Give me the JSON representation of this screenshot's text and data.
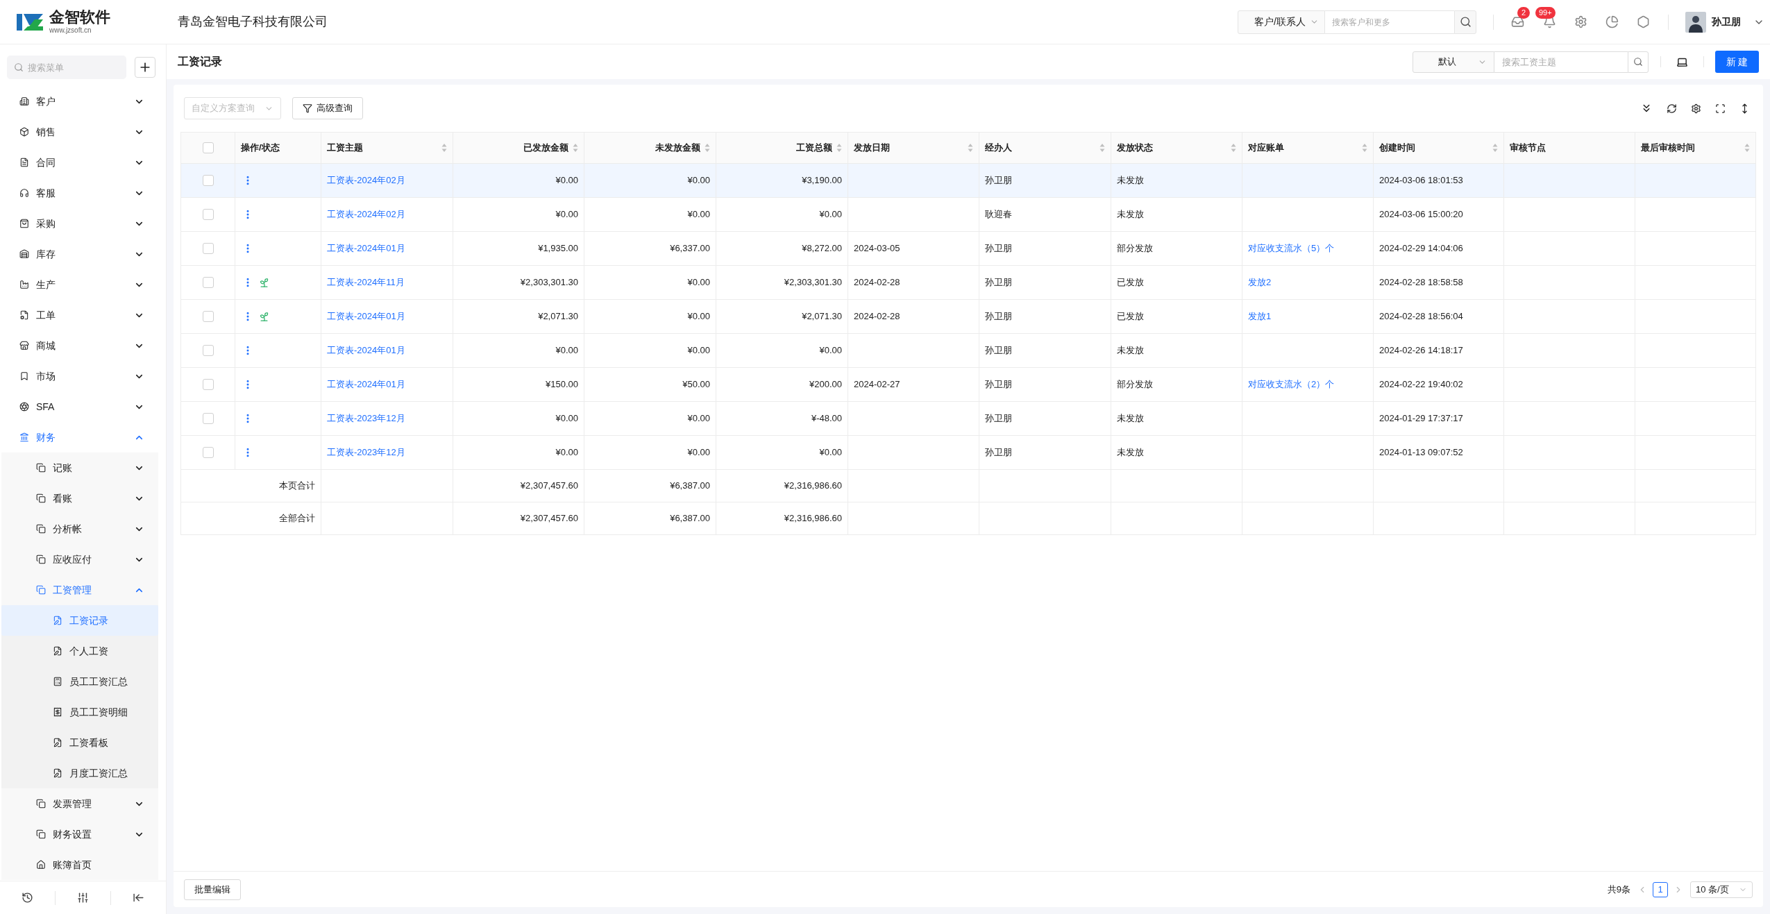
{
  "topbar": {
    "logo": {
      "name": "金智软件",
      "url": "www.jzsoft.cn"
    },
    "company": "青岛金智电子科技有限公司",
    "search": {
      "scope": "客户/联系人",
      "placeholder": "搜索客户和更多"
    },
    "inbox_badge": "2",
    "bell_badge": "99+",
    "user": "孙卫朋"
  },
  "sidebar": {
    "search": {
      "placeholder": "搜索菜单"
    },
    "items": [
      {
        "label": "客户",
        "expanded": false,
        "selected": false
      },
      {
        "label": "销售",
        "expanded": false,
        "selected": false
      },
      {
        "label": "合同",
        "expanded": false,
        "selected": false
      },
      {
        "label": "客服",
        "expanded": false,
        "selected": false
      },
      {
        "label": "采购",
        "expanded": false,
        "selected": false
      },
      {
        "label": "库存",
        "expanded": false,
        "selected": false
      },
      {
        "label": "生产",
        "expanded": false,
        "selected": false
      },
      {
        "label": "工单",
        "expanded": false,
        "selected": false
      },
      {
        "label": "商城",
        "expanded": false,
        "selected": false
      },
      {
        "label": "市场",
        "expanded": false,
        "selected": false
      },
      {
        "label": "SFA",
        "expanded": false,
        "selected": false
      },
      {
        "label": "财务",
        "expanded": true,
        "selected": false,
        "children": [
          {
            "label": "记账",
            "expanded": false,
            "selected": false
          },
          {
            "label": "看账",
            "expanded": false,
            "selected": false
          },
          {
            "label": "分析帐",
            "expanded": false,
            "selected": false
          },
          {
            "label": "应收应付",
            "expanded": false,
            "selected": false
          },
          {
            "label": "工资管理",
            "expanded": true,
            "selected": false,
            "children": [
              {
                "label": "工资记录",
                "selected": true
              },
              {
                "label": "个人工资",
                "selected": false
              },
              {
                "label": "员工工资汇总",
                "selected": false
              },
              {
                "label": "员工工资明细",
                "selected": false
              },
              {
                "label": "工资看板",
                "selected": false
              },
              {
                "label": "月度工资汇总",
                "selected": false
              }
            ]
          },
          {
            "label": "发票管理",
            "expanded": false,
            "selected": false
          },
          {
            "label": "财务设置",
            "expanded": false,
            "selected": false
          },
          {
            "label": "账簿首页",
            "selected": false
          }
        ]
      }
    ]
  },
  "page": {
    "title": "工资记录",
    "view": "默认",
    "search": {
      "placeholder": "搜索工资主题"
    },
    "new_button": "新 建"
  },
  "toolbar": {
    "scheme": {
      "placeholder": "自定义方案查询"
    },
    "advanced": "高级查询"
  },
  "table": {
    "select_all": {
      "checked": false
    },
    "columns": [
      {
        "label": "操作/状态",
        "sortable": false
      },
      {
        "label": "工资主题",
        "sortable": true
      },
      {
        "label": "已发放金额",
        "sortable": true
      },
      {
        "label": "未发放金额",
        "sortable": true
      },
      {
        "label": "工资总额",
        "sortable": true
      },
      {
        "label": "发放日期",
        "sortable": true
      },
      {
        "label": "经办人",
        "sortable": true
      },
      {
        "label": "发放状态",
        "sortable": true
      },
      {
        "label": "对应账单",
        "sortable": true
      },
      {
        "label": "创建时间",
        "sortable": true
      },
      {
        "label": "审核节点",
        "sortable": false
      },
      {
        "label": "最后审核时间",
        "sortable": true
      }
    ],
    "rows": [
      {
        "checked": false,
        "highlighted": true,
        "paid_icon": false,
        "subject": "工资表-2024年02月",
        "paid": "¥0.00",
        "unpaid": "¥0.00",
        "total": "¥3,190.00",
        "handler": "孙卫朋",
        "status": "未发放",
        "created": "2024-03-06 18:01:53"
      },
      {
        "checked": false,
        "highlighted": false,
        "paid_icon": false,
        "subject": "工资表-2024年02月",
        "paid": "¥0.00",
        "unpaid": "¥0.00",
        "total": "¥0.00",
        "handler": "耿迎春",
        "status": "未发放",
        "created": "2024-03-06 15:00:20"
      },
      {
        "checked": false,
        "highlighted": false,
        "paid_icon": false,
        "subject": "工资表-2024年01月",
        "paid": "¥1,935.00",
        "unpaid": "¥6,337.00",
        "total": "¥8,272.00",
        "date": "2024-03-05",
        "handler": "孙卫朋",
        "status": "部分发放",
        "bill": "对应收支流水（5）个",
        "created": "2024-02-29 14:04:06"
      },
      {
        "checked": false,
        "highlighted": false,
        "paid_icon": true,
        "subject": "工资表-2024年11月",
        "paid": "¥2,303,301.30",
        "unpaid": "¥0.00",
        "total": "¥2,303,301.30",
        "date": "2024-02-28",
        "handler": "孙卫朋",
        "status": "已发放",
        "bill": "发放2",
        "created": "2024-02-28 18:58:58"
      },
      {
        "checked": false,
        "highlighted": false,
        "paid_icon": true,
        "subject": "工资表-2024年01月",
        "paid": "¥2,071.30",
        "unpaid": "¥0.00",
        "total": "¥2,071.30",
        "date": "2024-02-28",
        "handler": "孙卫朋",
        "status": "已发放",
        "bill": "发放1",
        "created": "2024-02-28 18:56:04"
      },
      {
        "checked": false,
        "highlighted": false,
        "paid_icon": false,
        "subject": "工资表-2024年01月",
        "paid": "¥0.00",
        "unpaid": "¥0.00",
        "total": "¥0.00",
        "handler": "孙卫朋",
        "status": "未发放",
        "created": "2024-02-26 14:18:17"
      },
      {
        "checked": false,
        "highlighted": false,
        "paid_icon": false,
        "subject": "工资表-2024年01月",
        "paid": "¥150.00",
        "unpaid": "¥50.00",
        "total": "¥200.00",
        "date": "2024-02-27",
        "handler": "孙卫朋",
        "status": "部分发放",
        "bill": "对应收支流水（2）个",
        "created": "2024-02-22 19:40:02"
      },
      {
        "checked": false,
        "highlighted": false,
        "paid_icon": false,
        "subject": "工资表-2023年12月",
        "paid": "¥0.00",
        "unpaid": "¥0.00",
        "total": "¥-48.00",
        "handler": "孙卫朋",
        "status": "未发放",
        "created": "2024-01-29 17:37:17"
      },
      {
        "checked": false,
        "highlighted": false,
        "paid_icon": false,
        "subject": "工资表-2023年12月",
        "paid": "¥0.00",
        "unpaid": "¥0.00",
        "total": "¥0.00",
        "handler": "孙卫朋",
        "status": "未发放",
        "created": "2024-01-13 09:07:52"
      }
    ],
    "totals": [
      {
        "label": "本页合计",
        "paid": "¥2,307,457.60",
        "unpaid": "¥6,387.00",
        "total": "¥2,316,986.60"
      },
      {
        "label": "全部合计",
        "paid": "¥2,307,457.60",
        "unpaid": "¥6,387.00",
        "total": "¥2,316,986.60"
      }
    ]
  },
  "footer": {
    "batch_edit": "批量编辑",
    "count": "共9条",
    "pages": [
      {
        "label": "1",
        "selected": true
      }
    ],
    "page_size": "10 条/页"
  }
}
